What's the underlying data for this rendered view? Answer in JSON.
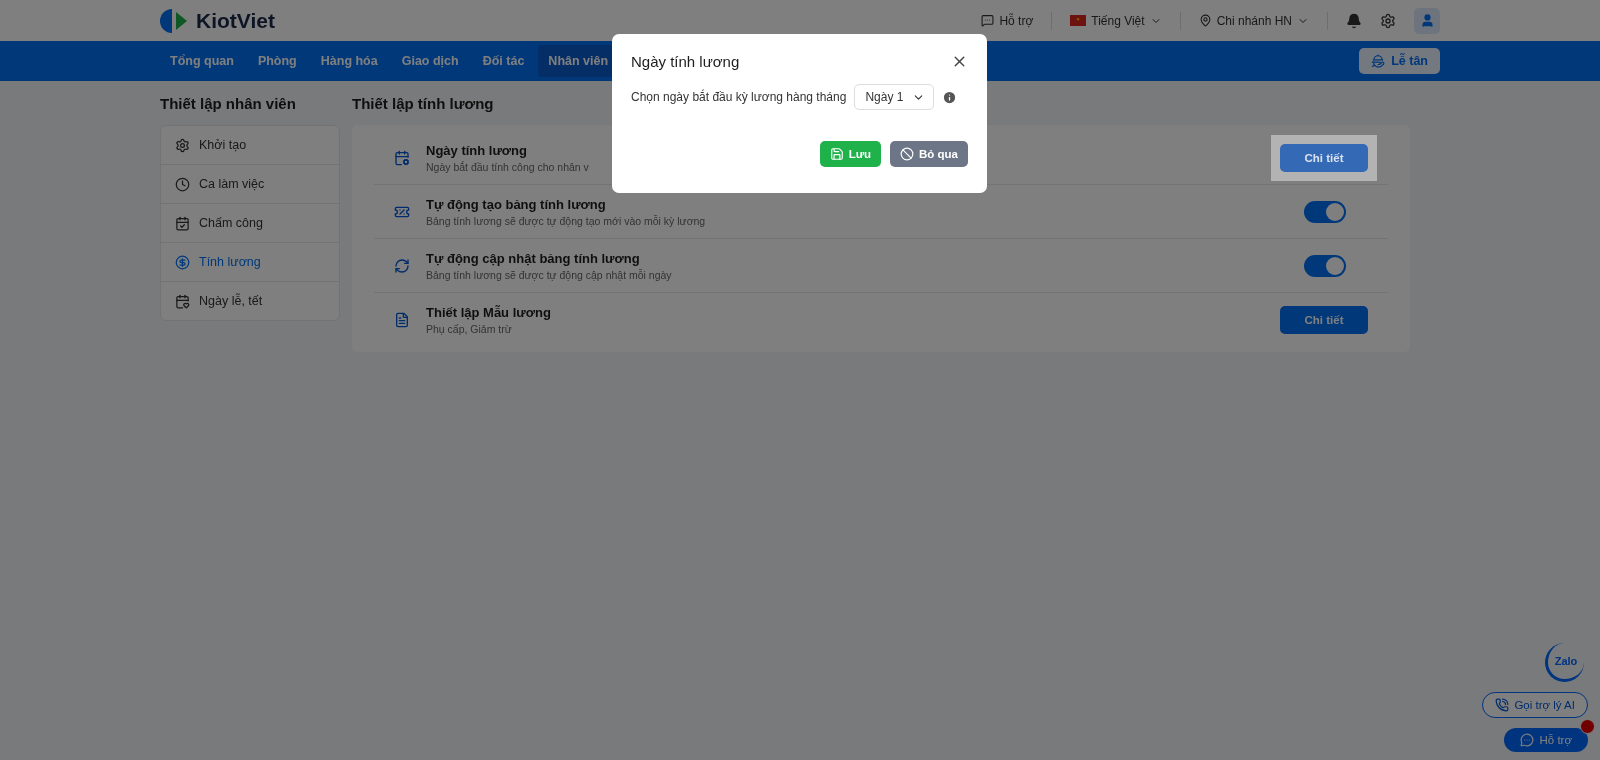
{
  "header": {
    "logo": "KiotViet",
    "support": "Hỗ trợ",
    "language": "Tiếng Việt",
    "branch": "Chi nhánh HN"
  },
  "nav": {
    "tabs": [
      {
        "label": "Tổng quan",
        "selected": false
      },
      {
        "label": "Phòng",
        "selected": false
      },
      {
        "label": "Hàng hóa",
        "selected": false
      },
      {
        "label": "Giao dịch",
        "selected": false
      },
      {
        "label": "Đối tác",
        "selected": false
      },
      {
        "label": "Nhân viên",
        "selected": true
      }
    ],
    "reception_button": "Lễ tân"
  },
  "sidebar": {
    "title": "Thiết lập nhân viên",
    "items": [
      {
        "label": "Khởi tạo",
        "selected": false
      },
      {
        "label": "Ca làm việc",
        "selected": false
      },
      {
        "label": "Chấm công",
        "selected": false
      },
      {
        "label": "Tính lương",
        "selected": true
      },
      {
        "label": "Ngày lễ, tết",
        "selected": false
      }
    ]
  },
  "main": {
    "title": "Thiết lập tính lương",
    "settings": [
      {
        "kind": "button",
        "title": "Ngày tính lương",
        "description": "Ngày bắt đầu tính công cho nhân v",
        "button": "Chi tiết",
        "highlighted": true
      },
      {
        "kind": "toggle",
        "title": "Tự động tạo bảng tính lương",
        "description": "Bảng tính lương sẽ được tự động tạo mới vào mỗi kỳ lương",
        "on": true
      },
      {
        "kind": "toggle",
        "title": "Tự động cập nhật bảng tính lương",
        "description": "Bảng tính lương sẽ được tự động cập nhật mỗi ngày",
        "on": true
      },
      {
        "kind": "button",
        "title": "Thiết lập Mẫu lương",
        "description": "Phụ cấp, Giảm trừ",
        "button": "Chi tiết",
        "highlighted": false
      }
    ]
  },
  "dialog": {
    "title": "Ngày tính lương",
    "label": "Chọn ngày bắt đầu kỳ lương hàng tháng",
    "select_value": "Ngày 1",
    "save_button": "Lưu",
    "cancel_button": "Bỏ qua"
  },
  "floating": {
    "zalo": "Zalo",
    "ai_button": "Gọi trợ lý AI",
    "support_button": "Hỗ trợ"
  }
}
